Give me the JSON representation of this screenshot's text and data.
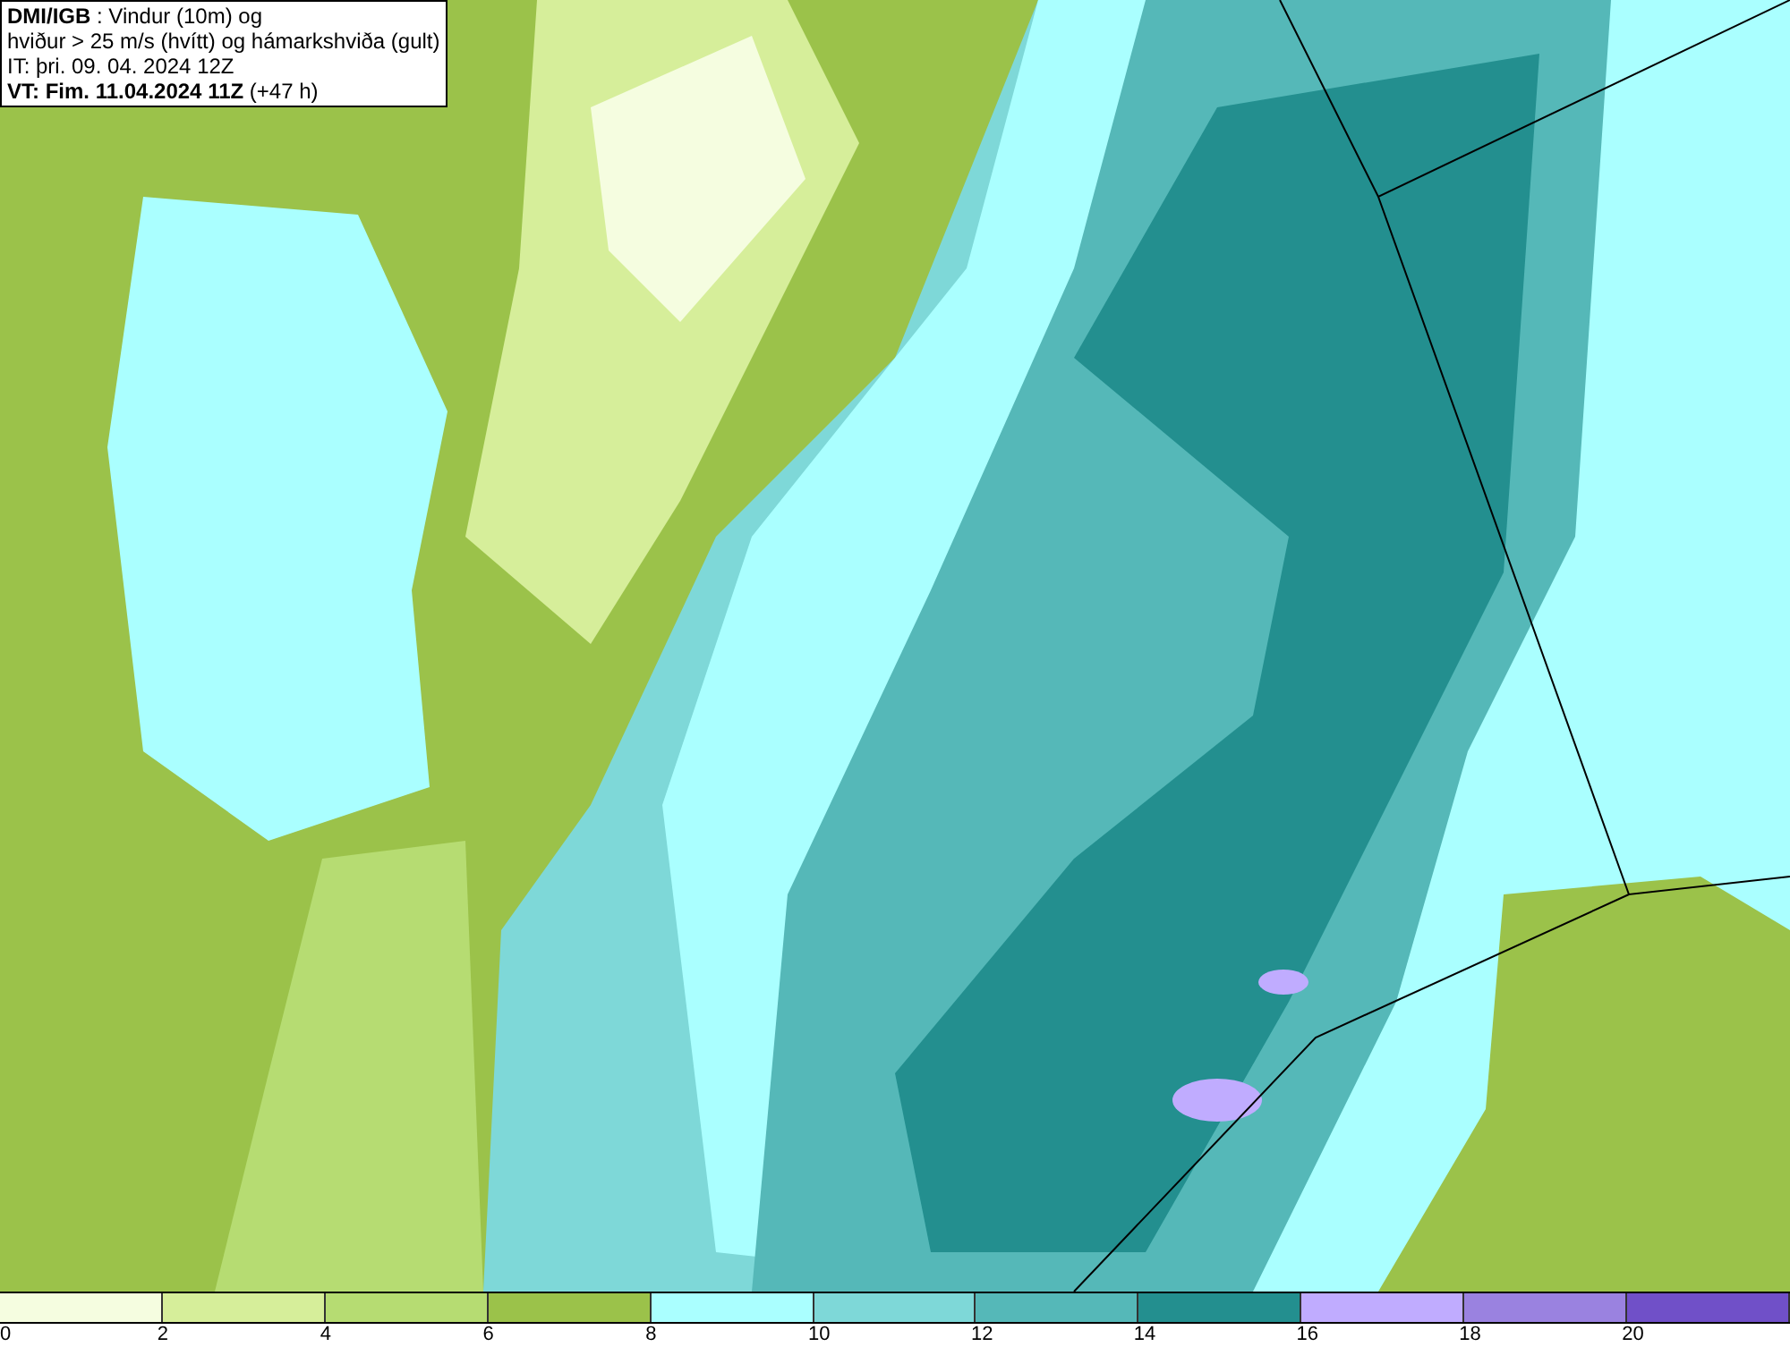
{
  "title_box": {
    "lines": [
      "**DMI/IGB** : Vindur (10m) og",
      "hviður > 25 m/s (hvítt) og hámarkshviða (gult)",
      "IT: þri. 09. 04. 2024 12Z",
      "**VT: Fim. 11.04.2024 11Z** (+47 h)"
    ]
  },
  "legend": {
    "bins": [
      {
        "color": "#f5fde0"
      },
      {
        "color": "#d6ee9a"
      },
      {
        "color": "#b6dc72"
      },
      {
        "color": "#9bc24a"
      },
      {
        "color": "#aaffff"
      },
      {
        "color": "#7ed8d8"
      },
      {
        "color": "#55b8b8"
      },
      {
        "color": "#238f8f"
      },
      {
        "color": "#c0acff"
      },
      {
        "color": "#9a82e0"
      },
      {
        "color": "#7050c8"
      }
    ],
    "ticks": [
      "0",
      "2",
      "4",
      "6",
      "8",
      "10",
      "12",
      "14",
      "16",
      "18",
      "20"
    ]
  }
}
